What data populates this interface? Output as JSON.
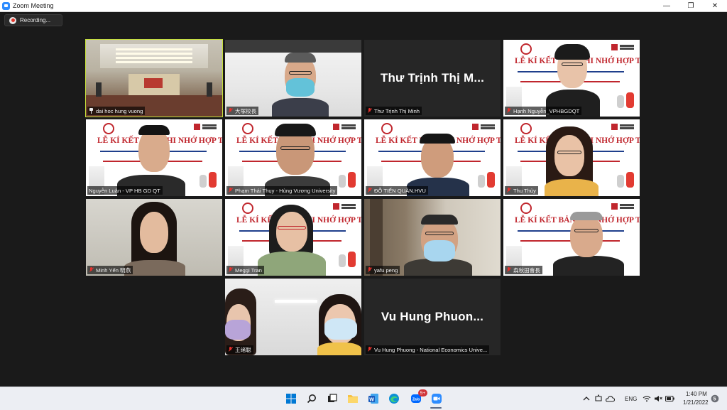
{
  "window": {
    "title": "Zoom Meeting",
    "minimize_icon": "minimize-icon",
    "maximize_icon": "restore-icon",
    "close_icon": "close-icon"
  },
  "recording": {
    "label": "Recording..."
  },
  "banner_text": "LỄ KÍ KẾT BẢN GHI NHỚ HỢP TÁC",
  "participants": [
    {
      "name": "dai hoc hung vuong",
      "muted": false,
      "pinned": true,
      "active_speaker": true
    },
    {
      "name": "大塚校長",
      "muted": true
    },
    {
      "name": "Thư Trịnh Thị Minh",
      "muted": true,
      "display_text": "Thư Trịnh Thị M..."
    },
    {
      "name": "Hạnh Nguyễn_VPHBGDQT",
      "muted": true
    },
    {
      "name": "Nguyễn Luân - VP HB GD QT",
      "muted": true
    },
    {
      "name": "Phạm Thái Thụy - Hùng Vương University",
      "muted": true
    },
    {
      "name": "ĐỖ TIẾN QUÂN.HVU",
      "muted": true
    },
    {
      "name": "Thu Thủy",
      "muted": true
    },
    {
      "name": "Minh Yến 明燕",
      "muted": true
    },
    {
      "name": "Meggi Tran",
      "muted": true
    },
    {
      "name": "yafu peng",
      "muted": true
    },
    {
      "name": "森秋田會長",
      "muted": true
    },
    {
      "name": "王绪聪",
      "muted": true
    },
    {
      "name": "Vu Hung Phuong - National Economics Unive...",
      "muted": true,
      "display_text": "Vu Hung Phuon..."
    }
  ],
  "taskbar": {
    "apps": [
      "windows-start-icon",
      "search-icon",
      "task-view-icon",
      "file-explorer-icon",
      "word-icon",
      "edge-icon",
      "zalo-icon",
      "zoom-icon"
    ],
    "zalo_badge": "5+",
    "language": "ENG",
    "time": "1:40 PM",
    "date": "1/21/2022"
  },
  "colors": {
    "background": "#1a1a1a",
    "active_outline": "#c6e03b",
    "muted_red": "#e5322d",
    "banner_red": "#c0262d"
  }
}
